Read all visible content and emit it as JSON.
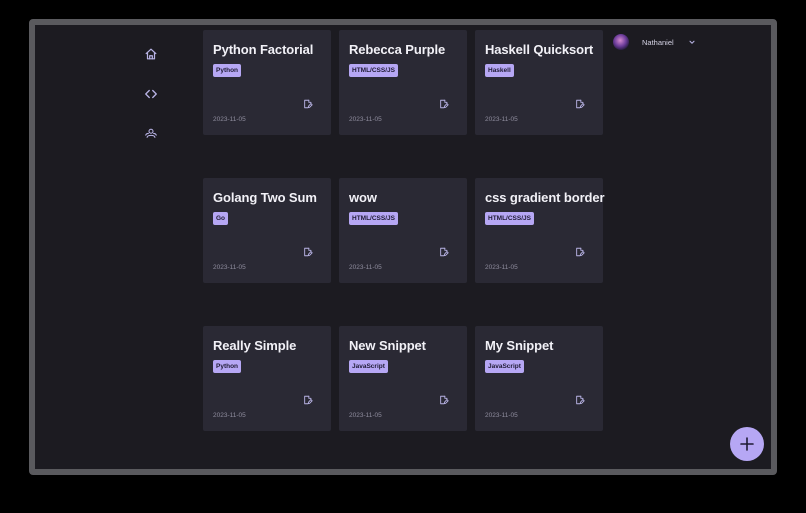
{
  "nav": {
    "items": [
      {
        "icon": "home-icon"
      },
      {
        "icon": "code-icon"
      },
      {
        "icon": "users-icon"
      }
    ]
  },
  "user": {
    "name": "Nathaniel",
    "avatar_icon": "avatar-image",
    "menu_icon": "chevron-down-icon"
  },
  "snippets": [
    {
      "title": "Python Factorial",
      "language": "Python",
      "date": "2023-11-05"
    },
    {
      "title": "Rebecca Purple",
      "language": "HTML/CSS/JS",
      "date": "2023-11-05"
    },
    {
      "title": "Haskell Quicksort",
      "language": "Haskell",
      "date": "2023-11-05"
    },
    {
      "title": "Golang Two Sum",
      "language": "Go",
      "date": "2023-11-05"
    },
    {
      "title": "wow",
      "language": "HTML/CSS/JS",
      "date": "2023-11-05"
    },
    {
      "title": "css gradient border",
      "language": "HTML/CSS/JS",
      "date": "2023-11-05"
    },
    {
      "title": "Really Simple",
      "language": "Python",
      "date": "2023-11-05"
    },
    {
      "title": "New Snippet",
      "language": "JavaScript",
      "date": "2023-11-05"
    },
    {
      "title": "My Snippet",
      "language": "JavaScript",
      "date": "2023-11-05"
    }
  ],
  "fab": {
    "icon": "plus-icon"
  },
  "colors": {
    "background": "#1c1b21",
    "card": "#2a2934",
    "accent": "#b6a7f4",
    "icon": "#b9b4e6",
    "frame": "#5a5a5e"
  }
}
